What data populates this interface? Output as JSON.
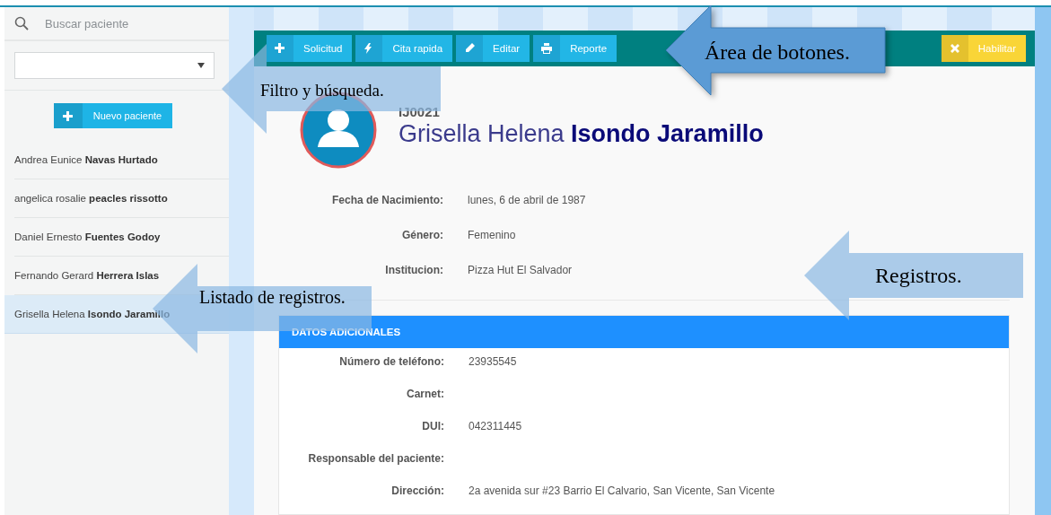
{
  "sidebar": {
    "search": {
      "placeholder": "Buscar paciente"
    },
    "new_button": {
      "label": "Nuevo paciente"
    },
    "patients": [
      {
        "name": "Andrea Eunice **Navas Hurtado**",
        "selected": false
      },
      {
        "name": "angelica rosalie **peacles rissotto**",
        "selected": false
      },
      {
        "name": "Daniel Ernesto **Fuentes Godoy**",
        "selected": false
      },
      {
        "name": "Fernando Gerard **Herrera Islas**",
        "selected": false
      },
      {
        "name": "Grisella Helena **Isondo Jaramillo**",
        "selected": true
      }
    ]
  },
  "toolbar": {
    "buttons": [
      {
        "label": "Solicitud",
        "kind": "info"
      },
      {
        "label": "Cita rapida",
        "kind": "info"
      },
      {
        "label": "Editar",
        "kind": "info"
      },
      {
        "label": "Reporte",
        "kind": "info"
      },
      {
        "label": "Habilitar",
        "kind": "warning"
      }
    ]
  },
  "patient": {
    "code": "IJ0021",
    "name": "Grisella Helena **Isondo Jaramillo**",
    "fields": [
      {
        "label": "Fecha de Nacimiento:",
        "value": "lunes, 6 de abril de 1987"
      },
      {
        "label": "Género:",
        "value": "Femenino"
      },
      {
        "label": "Institucion:",
        "value": "Pizza Hut El Salvador"
      }
    ]
  },
  "additional": {
    "title": "DATOS ADICIONALES",
    "fields": [
      {
        "label": "Número de teléfono:",
        "value": "23935545"
      },
      {
        "label": "Carnet:"
      },
      {
        "label": "DUI:",
        "value": "042311445"
      },
      {
        "label": "Responsable del paciente:"
      },
      {
        "label": "Dirección:",
        "value": "2a avenida sur #23 Barrio El Calvario, San Vicente, San Vicente"
      }
    ]
  },
  "callouts": [
    {
      "text": "Filtro y búsqueda.",
      "kind": "translucent"
    },
    {
      "text": "Área de botones.",
      "kind": "solid"
    },
    {
      "text": "Registros.",
      "kind": "translucent"
    },
    {
      "text": "Listado de registros.",
      "kind": "translucent"
    }
  ]
}
